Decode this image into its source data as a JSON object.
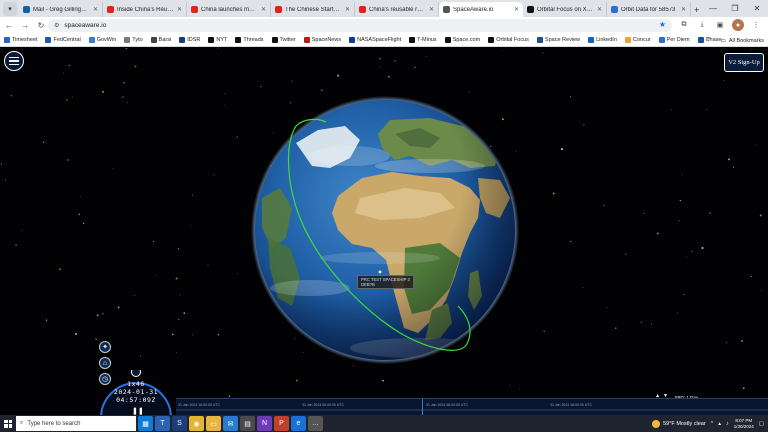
{
  "browser": {
    "tabs": [
      {
        "title": "Mail - Greg Gillinger - Outlook",
        "icon": "outlook-icon",
        "color": "#0a64ad"
      },
      {
        "title": "Inside China's Reusable Rocket",
        "icon": "youtube-icon",
        "color": "#e62117"
      },
      {
        "title": "China launches mystery spaceplane",
        "icon": "youtube-icon",
        "color": "#e62117"
      },
      {
        "title": "The Chinese Startup Just",
        "icon": "youtube-icon",
        "color": "#e62117"
      },
      {
        "title": "China's reusable rocket",
        "icon": "youtube-icon",
        "color": "#e62117"
      },
      {
        "title": "SpaceAware.io",
        "icon": "spaceaware-icon",
        "color": "#555555",
        "active": true
      },
      {
        "title": "Orbital Focus on X: \"Mini",
        "icon": "x-icon",
        "color": "#111111"
      },
      {
        "title": "Orbit Data for 58573",
        "icon": "star-icon",
        "color": "#2a6fd6"
      }
    ],
    "url": "spaceaware.io",
    "bookmarks": [
      {
        "label": "Timesheet",
        "color": "#2563c9"
      },
      {
        "label": "FedCentral",
        "color": "#1e5aa8"
      },
      {
        "label": "GovWin",
        "color": "#3a7bd5"
      },
      {
        "label": "Tyto",
        "color": "#7a7a7a"
      },
      {
        "label": "Barsi",
        "color": "#444444"
      },
      {
        "label": "IDSR",
        "color": "#1b3f7a"
      },
      {
        "label": "NYT",
        "color": "#111111"
      },
      {
        "label": "Threads",
        "color": "#111111"
      },
      {
        "label": "Twitter",
        "color": "#111111"
      },
      {
        "label": "SpaceNews",
        "color": "#b71c1c"
      },
      {
        "label": "NASASpaceFlight",
        "color": "#0b3d91"
      },
      {
        "label": "T-Minus",
        "color": "#111111"
      },
      {
        "label": "Space.com",
        "color": "#111111"
      },
      {
        "label": "Orbital Focus",
        "color": "#111111"
      },
      {
        "label": "Space Review",
        "color": "#1f4e8c"
      },
      {
        "label": "LinkedIn",
        "color": "#0a66c2"
      },
      {
        "label": "Concur",
        "color": "#f0a030"
      },
      {
        "label": "Per Diem",
        "color": "#2a6fd6"
      },
      {
        "label": "Chase",
        "color": "#1a4fa0"
      }
    ],
    "all_bookmarks_label": "All Bookmarks"
  },
  "app": {
    "signup_label": "V2 Sign-Up",
    "satellite_label": "PRC TEST SPACESHIP 3\nDEB?B",
    "speed": "1x46",
    "date": "2024-01-31",
    "time": "04:57:09Z",
    "speed_readout": "SPD: 1 Day",
    "timeline_ticks": [
      "31 Jan 2024 16:00:00 UTC",
      "31 Jan 2024 00:00:00 UTC",
      "31 Jan 2024 08:00:00 UTC",
      "31 Jan 2024 16:00:00 UTC"
    ]
  },
  "taskbar": {
    "search_placeholder": "Type here to search",
    "weather": "59°F  Mostly clear",
    "clock_time": "8:07 PM",
    "clock_date": "1/30/2024"
  }
}
